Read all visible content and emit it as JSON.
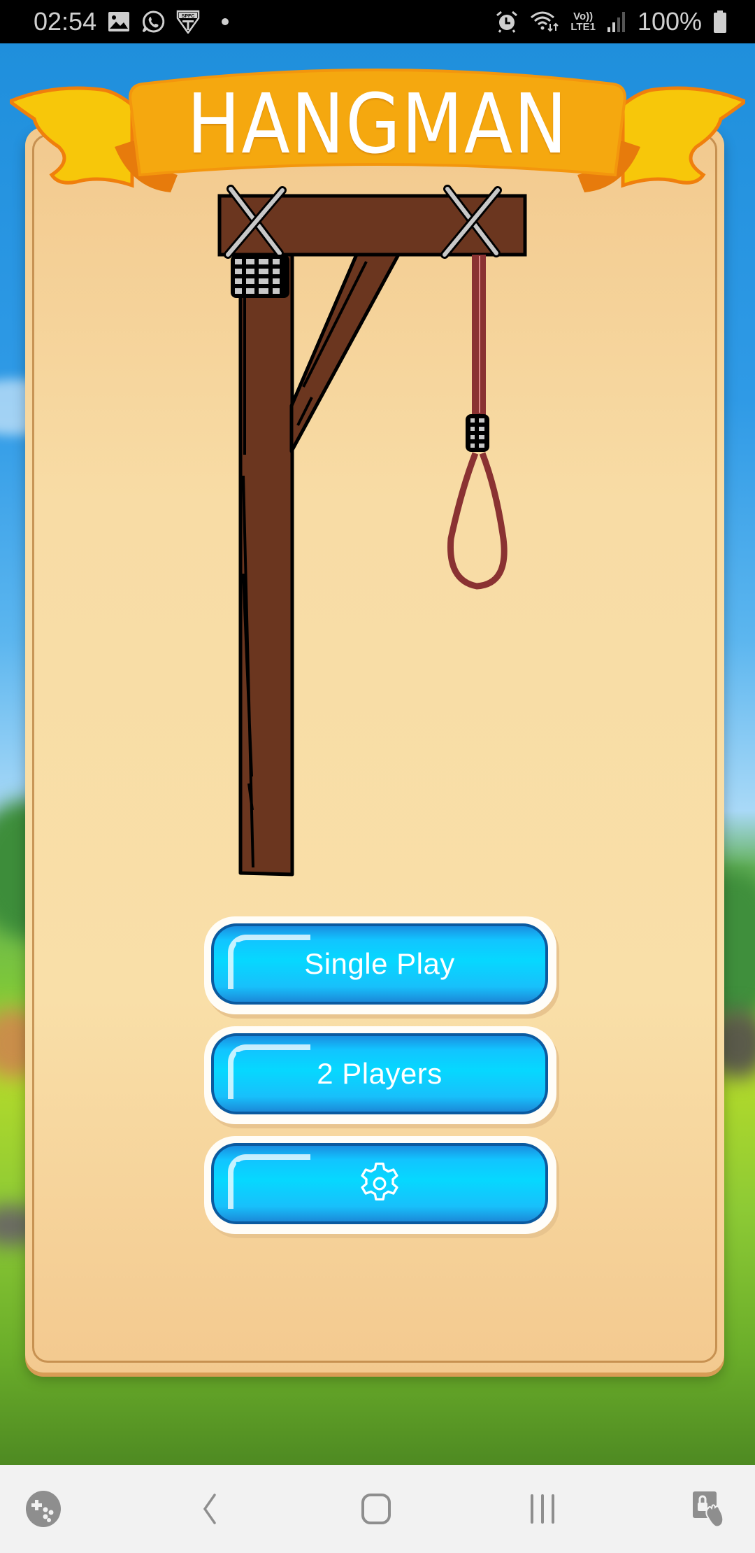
{
  "status_bar": {
    "time": "02:54",
    "notification_icons": [
      "gallery-icon",
      "whatsapp-icon",
      "spfc-badge-icon",
      "more-dot-icon"
    ],
    "spfc_text": "SPFC",
    "system_icons": [
      "alarm-icon",
      "wifi-icon",
      "volte-lte-icon",
      "signal-icon",
      "battery-icon"
    ],
    "volte_label": "Vo))",
    "lte_label": "LTE1",
    "battery_percent": "100%"
  },
  "game": {
    "title": "HANGMAN",
    "illustration": "gallows-with-noose",
    "colors": {
      "banner_center": "#f5a80f",
      "banner_wing": "#f7c70a",
      "banner_edge": "#f07f0c",
      "wood": "#6b361f",
      "rope": "#8a3232",
      "panel": "#f9dda6",
      "button": "#06d8ff",
      "button_border": "#0b5a9f"
    },
    "menu": [
      {
        "id": "single-play",
        "label": "Single Play"
      },
      {
        "id": "two-players",
        "label": "2 Players"
      },
      {
        "id": "settings",
        "label": "",
        "icon": "gear-icon"
      }
    ]
  },
  "nav_bar": {
    "buttons": [
      {
        "id": "game-tools",
        "icon": "game-controller-icon"
      },
      {
        "id": "back",
        "icon": "back-chevron-icon"
      },
      {
        "id": "home",
        "icon": "home-icon"
      },
      {
        "id": "recents",
        "icon": "recents-icon"
      },
      {
        "id": "touch-lock",
        "icon": "touch-lock-icon"
      }
    ]
  }
}
